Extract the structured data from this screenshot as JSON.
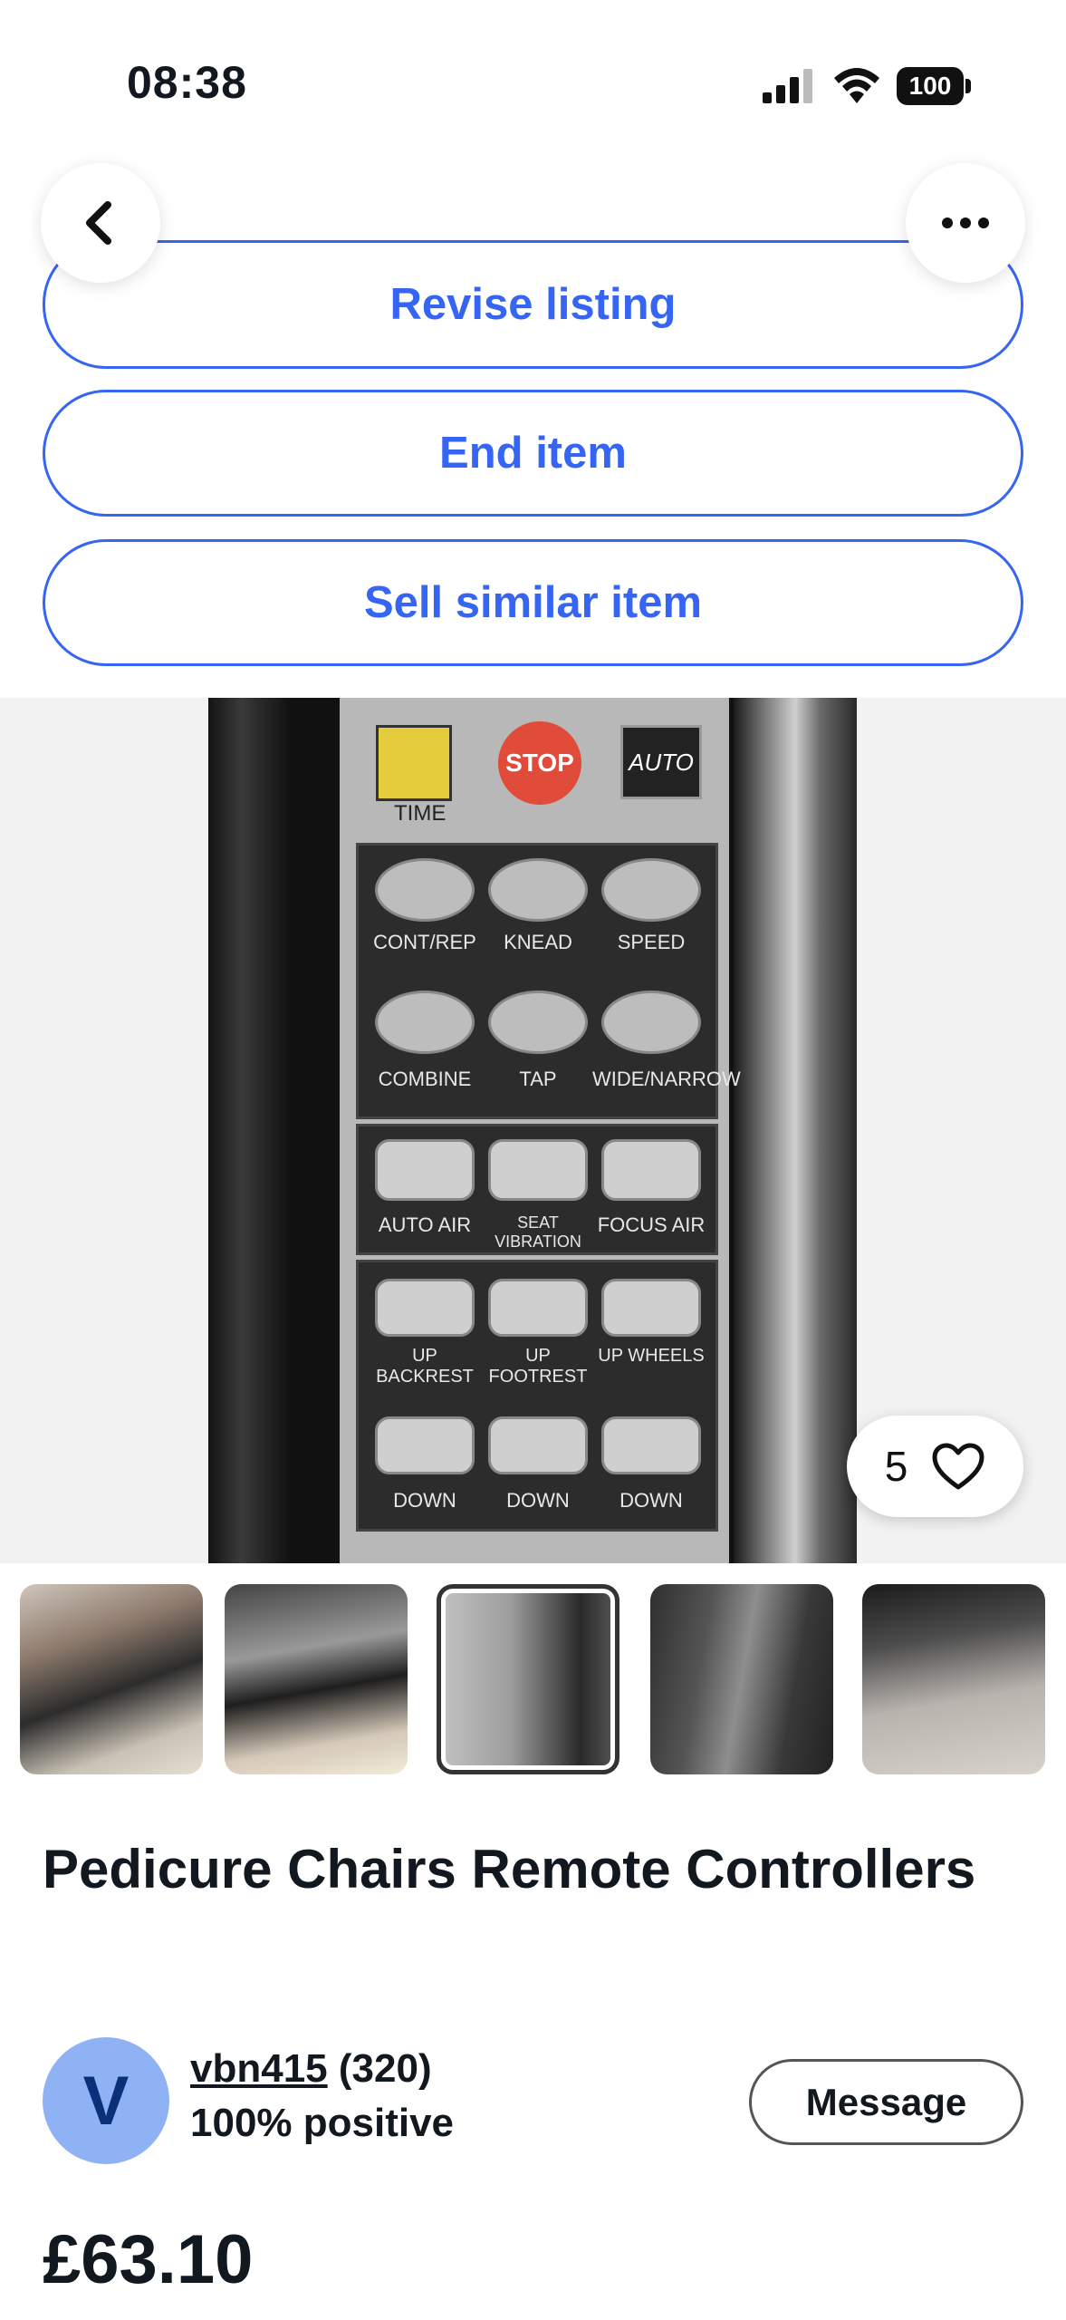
{
  "status_bar": {
    "time": "08:38",
    "battery": "100",
    "icons": [
      "signal-icon",
      "wifi-icon",
      "battery-icon"
    ]
  },
  "nav": {
    "back_icon": "chevron-left-icon",
    "more_icon": "more-horizontal-icon"
  },
  "actions": {
    "revise_label": "Revise listing",
    "end_label": "End item",
    "sell_similar_label": "Sell similar item"
  },
  "gallery": {
    "favorite_count": "5",
    "favorite_icon": "heart-icon",
    "selected_thumbnail": 3,
    "thumbnail_count": 5,
    "photo_labels": {
      "time": "TIME",
      "stop": "STOP",
      "auto": "AUTO",
      "keys": [
        "CONT/REP",
        "KNEAD",
        "SPEED",
        "COMBINE",
        "TAP",
        "WIDE/NARROW",
        "AUTO AIR",
        "SEAT VIBRATION",
        "FOCUS AIR",
        "UP BACKREST",
        "UP FOOTREST",
        "UP WHEELS",
        "DOWN",
        "DOWN",
        "DOWN"
      ]
    }
  },
  "listing": {
    "title": "Pedicure Chairs Remote Controllers",
    "price": "£63.10"
  },
  "seller": {
    "avatar_letter": "V",
    "username": "vbn415",
    "feedback_count": "(320)",
    "positive": "100% positive",
    "message_label": "Message"
  },
  "colors": {
    "accent": "#3665f3",
    "avatar_bg": "#8fb2f5",
    "text": "#111820"
  }
}
